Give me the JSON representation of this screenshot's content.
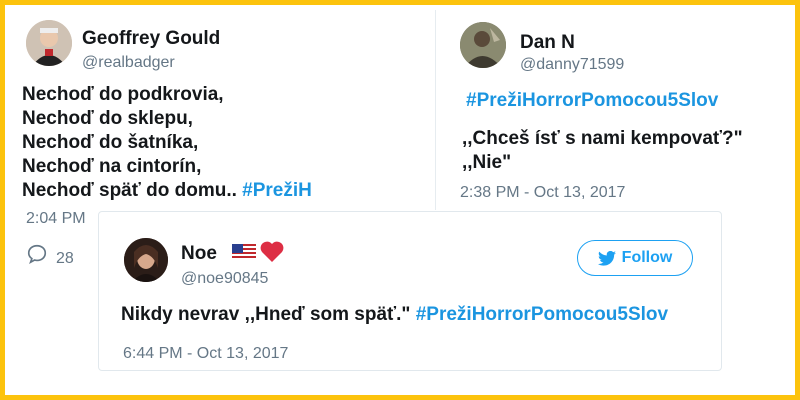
{
  "tweet_left": {
    "name": "Geoffrey Gould",
    "handle": "@realbadger",
    "lines": [
      "Nechoď do podkrovia,",
      "Nechoď do sklepu,",
      "Nechoď do šatníka,",
      "Nechoď na cintorín,",
      "Nechoď späť do domu.."
    ],
    "hashtag_cut": "#PrežiH",
    "time": "2:04 PM",
    "reply_count": "28",
    "avatar_icon": "profile-photo"
  },
  "tweet_right": {
    "name": "Dan N",
    "handle": "@danny71599",
    "hashtag": "#PrežiHorrorPomocou5Slov",
    "lines": [
      ",,Chceš ísť s nami kempovať?\"",
      ",,Nie\""
    ],
    "time": "2:38 PM - Oct 13, 2017",
    "avatar_icon": "profile-photo"
  },
  "tweet_overlay": {
    "name": "Noe",
    "handle": "@noe90845",
    "text": "Nikdy nevrav ,,Hneď som späť.\"",
    "hashtag": "#PrežiHorrorPomocou5Slov",
    "time": "6:44 PM - Oct 13, 2017",
    "follow_label": "Follow",
    "emoji": [
      "us-flag",
      "red-heart"
    ]
  },
  "colors": {
    "frame": "#fcc30d",
    "hashtag": "#1b95e0",
    "follow": "#1da1f2",
    "muted": "#657786",
    "text": "#14171a"
  }
}
